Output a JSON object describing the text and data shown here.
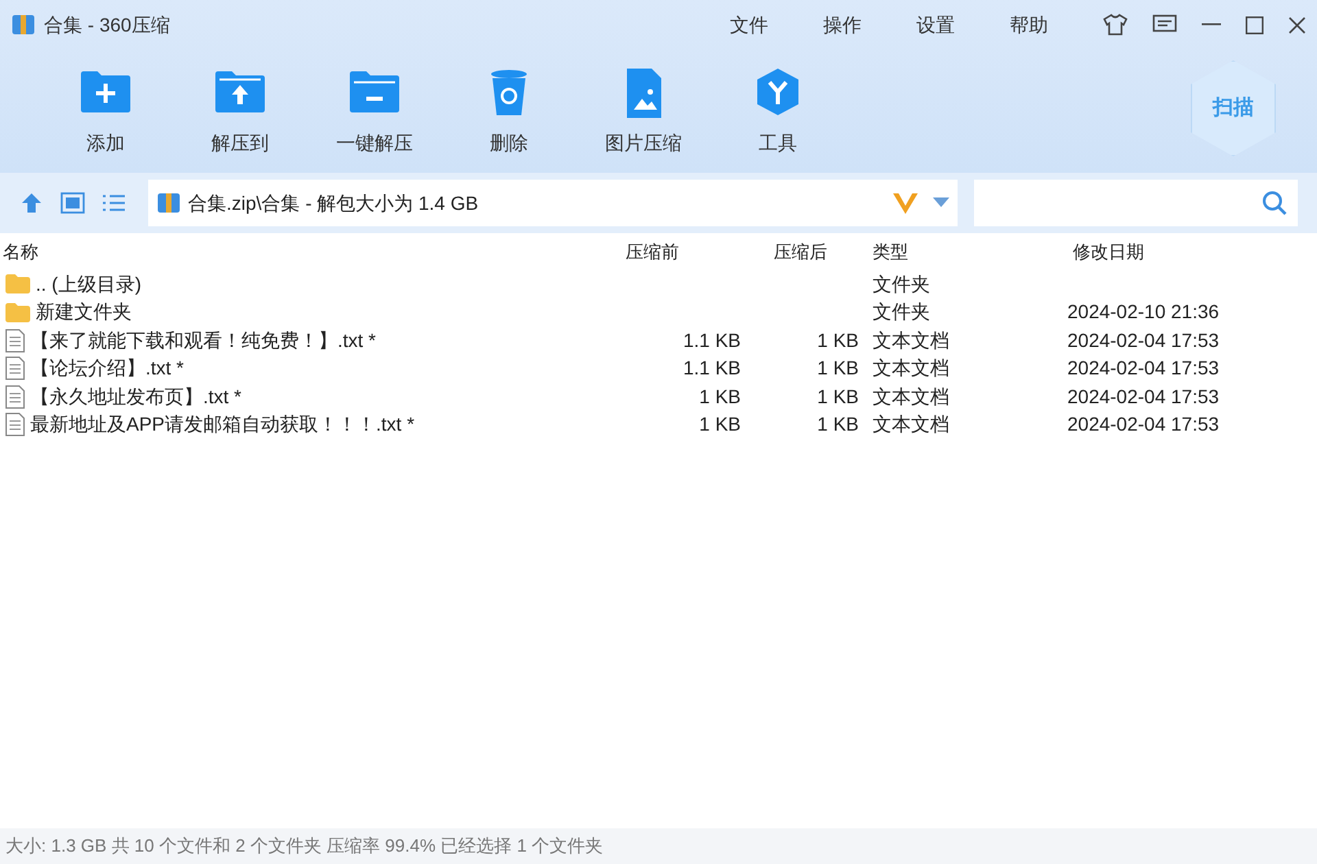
{
  "window": {
    "title": "合集 - 360压缩"
  },
  "menu": [
    "文件",
    "操作",
    "设置",
    "帮助"
  ],
  "toolbar": [
    {
      "kind": "add",
      "label": "添加"
    },
    {
      "kind": "extract",
      "label": "解压到"
    },
    {
      "kind": "oneclick",
      "label": "一键解压"
    },
    {
      "kind": "delete",
      "label": "删除"
    },
    {
      "kind": "image",
      "label": "图片压缩"
    },
    {
      "kind": "tools",
      "label": "工具"
    }
  ],
  "scan_button": {
    "label": "扫描"
  },
  "address_bar": {
    "path": "合集.zip\\合集 - 解包大小为 1.4 GB"
  },
  "table": {
    "columns": [
      "名称",
      "压缩前",
      "压缩后",
      "类型",
      "修改日期"
    ],
    "rows": [
      {
        "kind": "folder",
        "name": ".. (上级目录)",
        "type": "文件夹"
      },
      {
        "kind": "folder",
        "name": "新建文件夹",
        "type": "文件夹",
        "modified": "2024-02-10 21:36"
      },
      {
        "kind": "file",
        "name": "【来了就能下载和观看！纯免费！】.txt *",
        "original": "1.1 KB",
        "compressed": "1 KB",
        "type": "文本文档",
        "modified": "2024-02-04 17:53"
      },
      {
        "kind": "file",
        "name": "【论坛介绍】.txt *",
        "original": "1.1 KB",
        "compressed": "1 KB",
        "type": "文本文档",
        "modified": "2024-02-04 17:53"
      },
      {
        "kind": "file",
        "name": "【永久地址发布页】.txt *",
        "original": "1 KB",
        "compressed": "1 KB",
        "type": "文本文档",
        "modified": "2024-02-04 17:53"
      },
      {
        "kind": "file",
        "name": "最新地址及APP请发邮箱自动获取！！！.txt *",
        "original": "1 KB",
        "compressed": "1 KB",
        "type": "文本文档",
        "modified": "2024-02-04 17:53"
      }
    ]
  },
  "status_bar": "大小: 1.3 GB 共 10 个文件和 2 个文件夹 压缩率 99.4% 已经选择 1 个文件夹"
}
